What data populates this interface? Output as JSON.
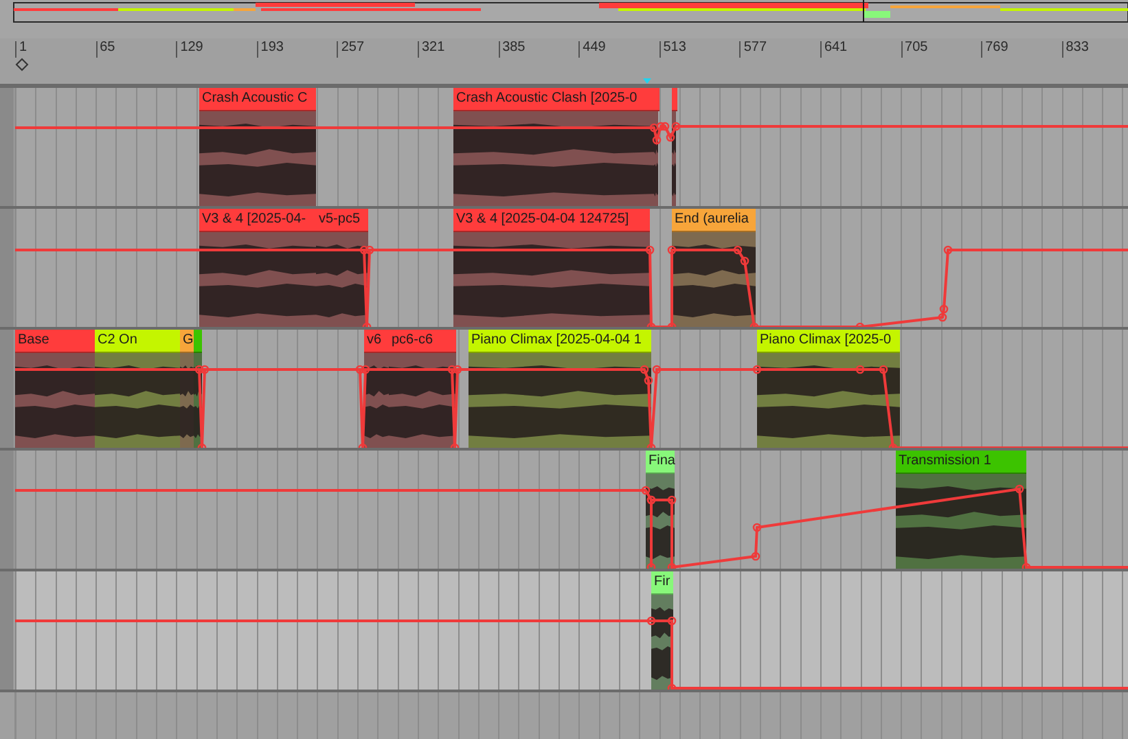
{
  "ruler": {
    "marks": [
      "1",
      "65",
      "129",
      "193",
      "257",
      "321",
      "385",
      "449",
      "513",
      "577",
      "641",
      "705",
      "769",
      "833"
    ]
  },
  "tracks": [
    {
      "selected": false,
      "clips": [
        {
          "name": "Crash Acoustic C",
          "color": "#ff3c3c"
        },
        {
          "name": "Crash Acoustic Clash [2025-0",
          "color": "#ff3c3c"
        },
        {
          "color": "#ff3c3c"
        },
        {
          "color": "#ff3c3c"
        }
      ]
    },
    {
      "selected": false,
      "clips": [
        {
          "name": "V3 & 4 [2025-04-",
          "color": "#ff3c3c"
        },
        {
          "name": "v5-pc5",
          "color": "#ff3c3c"
        },
        {
          "name": "V3 & 4 [2025-04-04 124725]",
          "color": "#ff3c3c"
        },
        {
          "name": "End (aurelia",
          "color": "#f7a53a"
        }
      ]
    },
    {
      "selected": false,
      "clips": [
        {
          "name": "Base",
          "color": "#ff3c3c"
        },
        {
          "name": "C2 On",
          "color": "#c4f500"
        },
        {
          "name": "G",
          "color": "#f7a53a"
        },
        {
          "color": "#3cc300"
        },
        {
          "name": "v6",
          "color": "#ff3c3c"
        },
        {
          "name": "pc6-c6",
          "color": "#ff3c3c"
        },
        {
          "name": "Piano Climax [2025-04-04 1",
          "color": "#c4f500"
        },
        {
          "name": "Piano Climax [2025-0",
          "color": "#c4f500"
        }
      ]
    },
    {
      "selected": false,
      "clips": [
        {
          "name": "Fina",
          "color": "#88f77a"
        },
        {
          "name": "Transmission 1",
          "color": "#3cc300"
        }
      ]
    },
    {
      "selected": true,
      "clips": [
        {
          "name": "Fir",
          "color": "#88f77a"
        }
      ]
    }
  ]
}
